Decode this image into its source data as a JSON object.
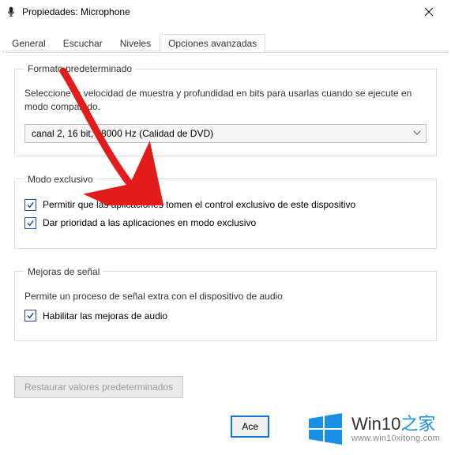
{
  "window": {
    "title": "Propiedades: Microphone"
  },
  "tabs": {
    "general": "General",
    "escuchar": "Escuchar",
    "niveles": "Niveles",
    "opciones": "Opciones avanzadas"
  },
  "defaultFormat": {
    "legend": "Formato predeterminado",
    "desc": "Seleccione la velocidad de muestra y profundidad en bits para usarlas cuando se ejecute en modo compartido.",
    "selected": "canal 2, 16 bit, 48000 Hz (Calidad de DVD)"
  },
  "exclusive": {
    "legend": "Modo exclusivo",
    "chk1": "Permitir que las aplicaciones tomen el control exclusivo de este dispositivo",
    "chk2": "Dar prioridad a las aplicaciones en modo exclusivo"
  },
  "signal": {
    "legend": "Mejoras de señal",
    "desc": "Permite un proceso de señal extra con el dispositivo de audio",
    "chk": "Habilitar las mejoras de audio"
  },
  "buttons": {
    "restore": "Restaurar valores predeterminados",
    "ok": "Ace"
  },
  "watermark": {
    "line1a": "Win10",
    "line1b": "之家",
    "line2": "www.win10xitong.com"
  }
}
